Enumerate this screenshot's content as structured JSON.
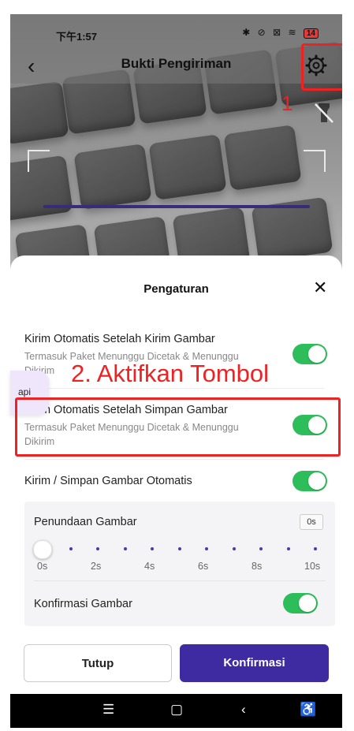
{
  "status_bar": {
    "time": "下午1:57",
    "battery": "14"
  },
  "header": {
    "title": "Bukti Pengiriman"
  },
  "annotations": {
    "step1": "1",
    "step2": "2. Aktifkan Tombol"
  },
  "sheet": {
    "title": "Pengaturan",
    "settings": [
      {
        "title": "Kirim Otomatis Setelah Kirim Gambar",
        "desc": "Termasuk Paket Menunggu Dicetak & Menunggu Dikirim",
        "enabled": true
      },
      {
        "title": "Kirim Otomatis Setelah Simpan Gambar",
        "desc": "Termasuk Paket Menunggu Dicetak & Menunggu Dikirim",
        "enabled": true
      },
      {
        "title": "Kirim / Simpan Gambar Otomatis",
        "enabled": true
      }
    ],
    "delay": {
      "label": "Penundaan Gambar",
      "value": "0s",
      "ticks": [
        "0s",
        "2s",
        "4s",
        "6s",
        "8s",
        "10s"
      ]
    },
    "confirm": {
      "label": "Konfirmasi Gambar",
      "enabled": true
    }
  },
  "buttons": {
    "close": "Tutup",
    "confirm": "Konfirmasi"
  },
  "floating": {
    "chip": "api"
  },
  "colors": {
    "accent": "#3e2aa1",
    "toggle_on": "#2dbd5a",
    "annotation": "#ee2222"
  },
  "icons": [
    "back-arrow-icon",
    "gear-icon",
    "flashlight-off-icon",
    "close-icon",
    "menu-icon",
    "home-icon",
    "back-icon",
    "accessibility-icon"
  ]
}
